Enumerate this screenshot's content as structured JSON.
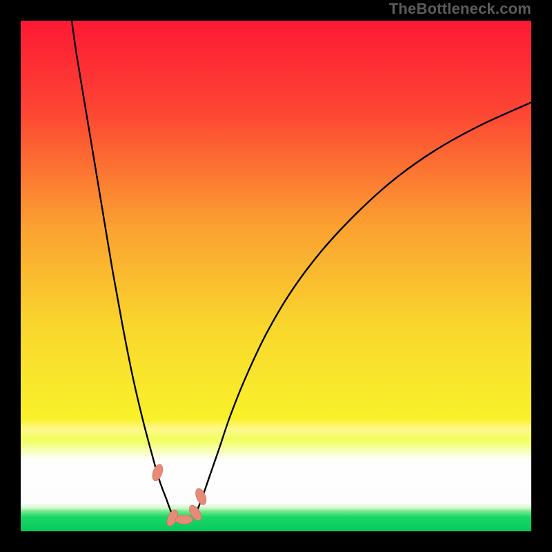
{
  "watermark": "TheBottleneck.com",
  "colors": {
    "frame": "#000000",
    "curve": "#000000",
    "marker_fill": "#e78a78",
    "marker_stroke": "#d06a59",
    "gradient": [
      {
        "stop": 0.0,
        "hex": "#fd1934"
      },
      {
        "stop": 0.18,
        "hex": "#fd4633"
      },
      {
        "stop": 0.4,
        "hex": "#fba031"
      },
      {
        "stop": 0.6,
        "hex": "#f9d72d"
      },
      {
        "stop": 0.78,
        "hex": "#f9f12a"
      },
      {
        "stop": 0.8,
        "hex": "#fff88f"
      },
      {
        "stop": 0.82,
        "hex": "#f0ff5c"
      },
      {
        "stop": 0.86,
        "hex": "#fefefe"
      },
      {
        "stop": 0.945,
        "hex": "#fdfdfd"
      },
      {
        "stop": 0.955,
        "hex": "#ccf7c7"
      },
      {
        "stop": 0.96,
        "hex": "#7ee98f"
      },
      {
        "stop": 0.972,
        "hex": "#17d867"
      },
      {
        "stop": 1.0,
        "hex": "#08c85a"
      }
    ]
  },
  "chart_data": {
    "type": "line",
    "title": "",
    "xlabel": "",
    "ylabel": "",
    "xlim": [
      0,
      100
    ],
    "ylim": [
      0,
      100
    ],
    "grid": false,
    "legend": "none",
    "series": [
      {
        "name": "left-branch",
        "x": [
          10,
          11,
          12.5,
          14,
          16,
          18,
          20,
          22,
          24,
          26,
          27,
          27.8,
          28.5,
          29,
          29.7
        ],
        "values": [
          100,
          93,
          84,
          75,
          63,
          51,
          40,
          30,
          21.5,
          14,
          10.5,
          8.2,
          6.4,
          5.0,
          3.2
        ]
      },
      {
        "name": "right-branch",
        "x": [
          34.2,
          35.5,
          37,
          38.8,
          41,
          44,
          48,
          53,
          59,
          66,
          73,
          81,
          90,
          100
        ],
        "values": [
          3.2,
          6.5,
          10.8,
          16,
          22.5,
          30,
          38.5,
          47,
          55,
          62.5,
          68.8,
          74.5,
          79.5,
          84
        ]
      }
    ],
    "markers": [
      {
        "name": "m1",
        "x": 26.8,
        "y": 11.5,
        "rot": -70
      },
      {
        "name": "m2",
        "x": 29.7,
        "y": 2.6,
        "rot": -65
      },
      {
        "name": "m3",
        "x": 32.0,
        "y": 2.3,
        "rot": 0
      },
      {
        "name": "m4",
        "x": 34.2,
        "y": 3.6,
        "rot": 58
      },
      {
        "name": "m5",
        "x": 35.3,
        "y": 6.8,
        "rot": 68
      }
    ]
  }
}
